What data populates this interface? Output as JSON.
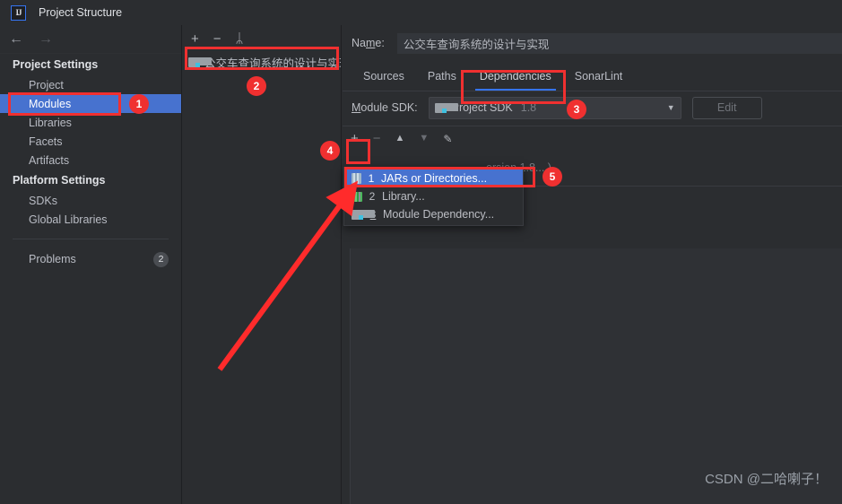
{
  "window": {
    "title": "Project Structure",
    "logo_icon": "intellij-idea-logo-icon"
  },
  "nav": {
    "back_icon": "arrow-left-icon",
    "forward_icon": "arrow-right-icon"
  },
  "sidebar": {
    "sections": [
      {
        "heading": "Project Settings",
        "items": [
          {
            "label": "Project",
            "selected": false
          },
          {
            "label": "Modules",
            "selected": true
          },
          {
            "label": "Libraries",
            "selected": false
          },
          {
            "label": "Facets",
            "selected": false
          },
          {
            "label": "Artifacts",
            "selected": false
          }
        ]
      },
      {
        "heading": "Platform Settings",
        "items": [
          {
            "label": "SDKs",
            "selected": false
          },
          {
            "label": "Global Libraries",
            "selected": false
          }
        ]
      }
    ],
    "problems": {
      "label": "Problems",
      "count": "2"
    }
  },
  "modules_panel": {
    "toolbar": {
      "add_label": "+",
      "remove_label": "−",
      "copy_label": "ᛦ"
    },
    "items": [
      {
        "name": "公交车查询系统的设计与实现"
      }
    ]
  },
  "detail": {
    "name_field": {
      "label_pre": "Na",
      "label_mnemonic": "m",
      "label_post": "e:",
      "value": "公交车查询系统的设计与实现"
    },
    "tabs": [
      {
        "label": "Sources",
        "active": false
      },
      {
        "label": "Paths",
        "active": false
      },
      {
        "label": "Dependencies",
        "active": true
      },
      {
        "label": "SonarLint",
        "active": false
      }
    ],
    "sdk": {
      "label_mnemonic": "M",
      "label_rest": "odule SDK:",
      "value": "Project SDK",
      "version": "1.8",
      "caret_icon": "chevron-down-icon",
      "edit_label": "Edit"
    },
    "dep_toolbar": {
      "add_label": "+",
      "remove_label": "−",
      "up_label": "▲",
      "down_label": "▼",
      "edit_icon": "pencil-icon"
    },
    "dep_rows": [
      {
        "text": "ersion 1.8....)"
      }
    ]
  },
  "popup_menu": {
    "items": [
      {
        "num": "1",
        "label": "JARs or Directories...",
        "icon": "jar-icon",
        "selected": true,
        "mnemonic": false
      },
      {
        "num": "2",
        "label": "Library...",
        "icon": "library-icon",
        "selected": false,
        "mnemonic": false
      },
      {
        "num": "3",
        "label": "Module Dependency...",
        "icon": "module-icon",
        "selected": false,
        "mnemonic": true
      }
    ]
  },
  "annotations": {
    "accent_color": "#f03030",
    "badges": [
      {
        "num": "1"
      },
      {
        "num": "2"
      },
      {
        "num": "3"
      },
      {
        "num": "4"
      },
      {
        "num": "5"
      }
    ]
  },
  "watermark": {
    "text": "CSDN @二哈喇子！"
  }
}
